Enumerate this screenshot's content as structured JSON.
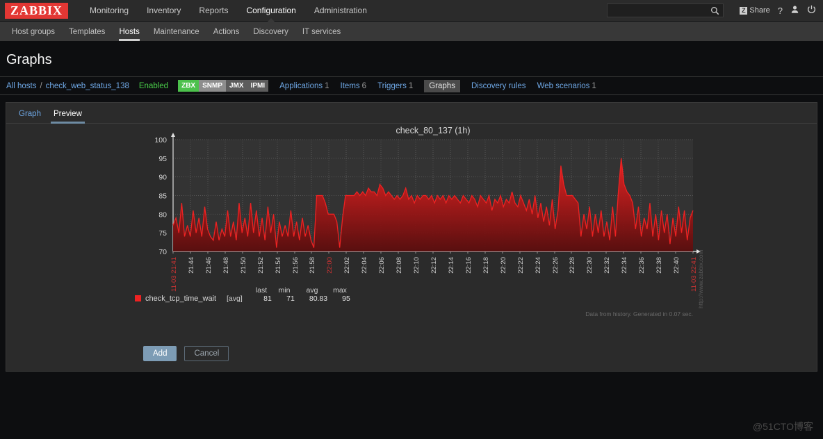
{
  "header": {
    "logo": "ZABBIX",
    "menu": [
      {
        "label": "Monitoring",
        "selected": false
      },
      {
        "label": "Inventory",
        "selected": false
      },
      {
        "label": "Reports",
        "selected": false
      },
      {
        "label": "Configuration",
        "selected": true
      },
      {
        "label": "Administration",
        "selected": false
      }
    ],
    "search": {
      "value": "",
      "placeholder": "",
      "icon": "search-icon"
    },
    "share_label": "Share",
    "share_icon": "zabbix-z-icon",
    "help_icon": "?",
    "user_icon": "person-icon",
    "power_icon": "power-icon"
  },
  "subnav": [
    {
      "label": "Host groups",
      "selected": false
    },
    {
      "label": "Templates",
      "selected": false
    },
    {
      "label": "Hosts",
      "selected": true
    },
    {
      "label": "Maintenance",
      "selected": false
    },
    {
      "label": "Actions",
      "selected": false
    },
    {
      "label": "Discovery",
      "selected": false
    },
    {
      "label": "IT services",
      "selected": false
    }
  ],
  "page": {
    "title": "Graphs"
  },
  "breadcrumb": {
    "all_hosts": "All hosts",
    "separator": "/",
    "host": "check_web_status_138",
    "status": "Enabled",
    "interfaces": [
      {
        "label": "ZBX",
        "state": "on"
      },
      {
        "label": "SNMP",
        "state": "off1"
      },
      {
        "label": "JMX",
        "state": "off2"
      },
      {
        "label": "IPMI",
        "state": "off2"
      }
    ],
    "entries": [
      {
        "label": "Applications",
        "count": "1",
        "current": false
      },
      {
        "label": "Items",
        "count": "6",
        "current": false
      },
      {
        "label": "Triggers",
        "count": "1",
        "current": false
      },
      {
        "label": "Graphs",
        "count": "",
        "current": true
      },
      {
        "label": "Discovery rules",
        "count": "",
        "current": false
      },
      {
        "label": "Web scenarios",
        "count": "1",
        "current": false
      }
    ]
  },
  "tabs": [
    {
      "label": "Graph",
      "selected": false
    },
    {
      "label": "Preview",
      "selected": true
    }
  ],
  "buttons": {
    "add": "Add",
    "cancel": "Cancel"
  },
  "graph_footer": "Data from history. Generated in 0.07 sec.",
  "graph_watermark": "http://www.zabbix.com",
  "page_watermark": "@51CTO博客",
  "colors": {
    "brand_red": "#e33734",
    "series_red": "#ee2222",
    "accent_blue": "#6fa8e6",
    "status_green": "#4ad04a",
    "panel_bg": "#2b2b2b",
    "page_bg": "#0d0e10",
    "plot_bg": "#333333"
  },
  "chart_data": {
    "type": "area",
    "title": "check_80_137 (1h)",
    "xlabel": "",
    "ylabel": "",
    "ylim": [
      70,
      100
    ],
    "yticks": [
      70,
      75,
      80,
      85,
      90,
      95,
      100
    ],
    "grid": true,
    "legend_position": "bottom-left",
    "series": [
      {
        "name": "check_tcp_time_wait",
        "aggregation": "[avg]",
        "color": "#ee2222",
        "stats": {
          "last": "81",
          "min": "71",
          "avg": "80.83",
          "max": "95"
        }
      }
    ],
    "stat_headers": [
      "last",
      "min",
      "avg",
      "max"
    ],
    "xticks": [
      {
        "label": "11-03 21:41",
        "highlight": true
      },
      {
        "label": "21:44",
        "highlight": false
      },
      {
        "label": "21:46",
        "highlight": false
      },
      {
        "label": "21:48",
        "highlight": false
      },
      {
        "label": "21:50",
        "highlight": false
      },
      {
        "label": "21:52",
        "highlight": false
      },
      {
        "label": "21:54",
        "highlight": false
      },
      {
        "label": "21:56",
        "highlight": false
      },
      {
        "label": "21:58",
        "highlight": false
      },
      {
        "label": "22:00",
        "highlight": true
      },
      {
        "label": "22:02",
        "highlight": false
      },
      {
        "label": "22:04",
        "highlight": false
      },
      {
        "label": "22:06",
        "highlight": false
      },
      {
        "label": "22:08",
        "highlight": false
      },
      {
        "label": "22:10",
        "highlight": false
      },
      {
        "label": "22:12",
        "highlight": false
      },
      {
        "label": "22:14",
        "highlight": false
      },
      {
        "label": "22:16",
        "highlight": false
      },
      {
        "label": "22:18",
        "highlight": false
      },
      {
        "label": "22:20",
        "highlight": false
      },
      {
        "label": "22:22",
        "highlight": false
      },
      {
        "label": "22:24",
        "highlight": false
      },
      {
        "label": "22:26",
        "highlight": false
      },
      {
        "label": "22:28",
        "highlight": false
      },
      {
        "label": "22:30",
        "highlight": false
      },
      {
        "label": "22:32",
        "highlight": false
      },
      {
        "label": "22:34",
        "highlight": false
      },
      {
        "label": "22:36",
        "highlight": false
      },
      {
        "label": "22:38",
        "highlight": false
      },
      {
        "label": "22:40",
        "highlight": false
      },
      {
        "label": "11-03 22:41",
        "highlight": true
      }
    ],
    "values": [
      77,
      79,
      75,
      83,
      74,
      77,
      74,
      81,
      75,
      79,
      74,
      82,
      76,
      74,
      73,
      78,
      73,
      76,
      74,
      81,
      74,
      78,
      73,
      83,
      75,
      79,
      74,
      83,
      75,
      81,
      74,
      79,
      73,
      82,
      75,
      80,
      71,
      78,
      74,
      77,
      74,
      81,
      74,
      78,
      73,
      79,
      74,
      77,
      73,
      71,
      85,
      85,
      85,
      83,
      80,
      80,
      80,
      78,
      71,
      79,
      85,
      85,
      85,
      85,
      86,
      85,
      86,
      85,
      87,
      86,
      86,
      85,
      88,
      87,
      85,
      86,
      85,
      84,
      85,
      84,
      85,
      87,
      84,
      85,
      83,
      85,
      84,
      85,
      85,
      84,
      85,
      83,
      85,
      84,
      85,
      83,
      85,
      84,
      85,
      84,
      83,
      85,
      84,
      83,
      85,
      84,
      82,
      85,
      84,
      83,
      85,
      81,
      84,
      83,
      85,
      82,
      84,
      83,
      86,
      83,
      82,
      85,
      83,
      81,
      84,
      80,
      85,
      79,
      83,
      78,
      82,
      77,
      84,
      76,
      81,
      93,
      88,
      85,
      85,
      85,
      84,
      83,
      74,
      80,
      76,
      82,
      74,
      80,
      75,
      81,
      74,
      78,
      73,
      82,
      74,
      86,
      95,
      88,
      86,
      85,
      83,
      76,
      82,
      74,
      79,
      76,
      83,
      74,
      80,
      73,
      81,
      75,
      80,
      72,
      79,
      74,
      82,
      75,
      81,
      73,
      79,
      81
    ]
  }
}
